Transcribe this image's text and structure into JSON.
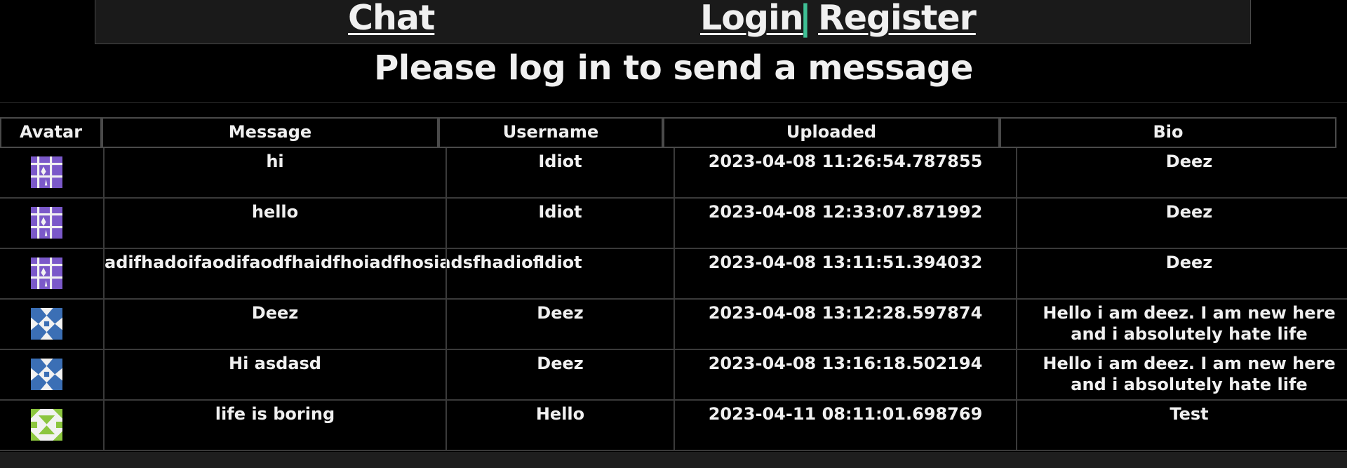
{
  "nav": {
    "chat": "Chat",
    "login": "Login",
    "separator": "|",
    "register": "Register"
  },
  "notice": "Please log in to send a message",
  "table": {
    "headers": [
      "Avatar",
      "Message",
      "Username",
      "Uploaded",
      "Bio"
    ],
    "rows": [
      {
        "avatar": "purple-identicon",
        "message": "hi",
        "username": "Idiot",
        "uploaded": "2023-04-08 11:26:54.787855",
        "bio": "Deez"
      },
      {
        "avatar": "purple-identicon",
        "message": "hello",
        "username": "Idiot",
        "uploaded": "2023-04-08 12:33:07.871992",
        "bio": "Deez"
      },
      {
        "avatar": "purple-identicon",
        "message": "adifhadoifaodifaodfhaidfhoiadfhosiadsfhadiof",
        "username": "Idiot",
        "uploaded": "2023-04-08 13:11:51.394032",
        "bio": "Deez"
      },
      {
        "avatar": "blue-identicon",
        "message": "Deez",
        "username": "Deez",
        "uploaded": "2023-04-08 13:12:28.597874",
        "bio": "Hello i am deez. I am new here and i absolutely hate life"
      },
      {
        "avatar": "blue-identicon",
        "message": "Hi asdasd",
        "username": "Deez",
        "uploaded": "2023-04-08 13:16:18.502194",
        "bio": "Hello i am deez. I am new here and i absolutely hate life"
      },
      {
        "avatar": "green-identicon",
        "message": "life is boring",
        "username": "Hello",
        "uploaded": "2023-04-11 08:11:01.698769",
        "bio": "Test"
      }
    ]
  },
  "colors": {
    "background": "#000000",
    "separator": "#3fbf94",
    "purple": "#7b59c9",
    "blue": "#3b6fb5",
    "green": "#8cc63f"
  }
}
